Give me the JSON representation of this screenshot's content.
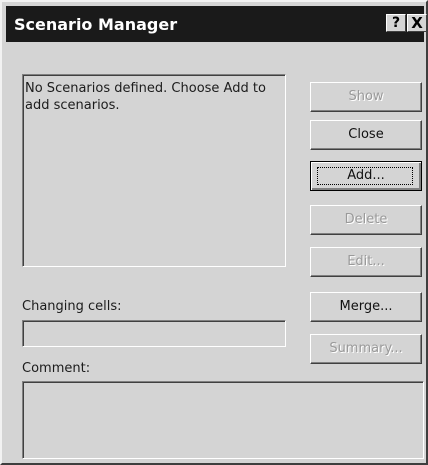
{
  "window": {
    "title": "Scenario Manager",
    "help_glyph": "?",
    "close_glyph": "X"
  },
  "scenarios": {
    "empty_message": "No Scenarios defined. Choose Add to add scenarios."
  },
  "buttons": {
    "show": "Show",
    "close": "Close",
    "add": "Add...",
    "delete": "Delete",
    "edit": "Edit...",
    "merge": "Merge...",
    "summary": "Summary..."
  },
  "fields": {
    "changing_cells_label": "Changing cells:",
    "changing_cells_value": "",
    "comment_label": "Comment:",
    "comment_value": ""
  }
}
